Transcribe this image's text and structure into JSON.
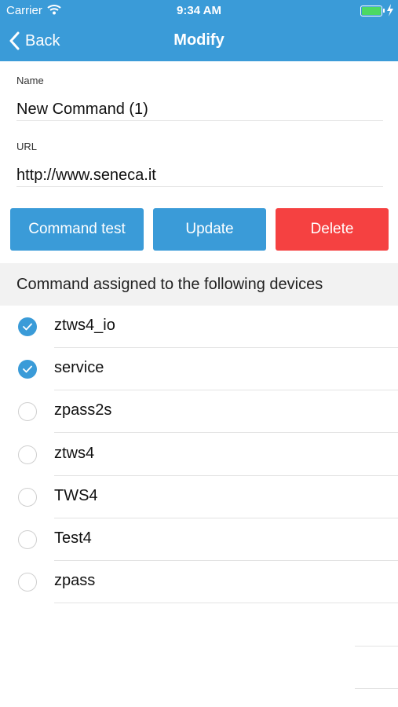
{
  "status_bar": {
    "carrier": "Carrier",
    "time": "9:34 AM"
  },
  "nav": {
    "back_label": "Back",
    "title": "Modify"
  },
  "form": {
    "name_label": "Name",
    "name_value": "New Command (1)",
    "url_label": "URL",
    "url_value": "http://www.seneca.it"
  },
  "buttons": {
    "command_test": "Command test",
    "update": "Update",
    "delete": "Delete"
  },
  "section": {
    "title": "Command assigned to the following devices"
  },
  "devices": [
    {
      "label": "ztws4_io",
      "checked": true
    },
    {
      "label": "service",
      "checked": true
    },
    {
      "label": "zpass2s",
      "checked": false
    },
    {
      "label": "ztws4",
      "checked": false
    },
    {
      "label": "TWS4",
      "checked": false
    },
    {
      "label": "Test4",
      "checked": false
    },
    {
      "label": "zpass",
      "checked": false
    }
  ],
  "colors": {
    "accent": "#3a9bd8",
    "danger": "#f54141",
    "section_bg": "#f2f2f2"
  }
}
